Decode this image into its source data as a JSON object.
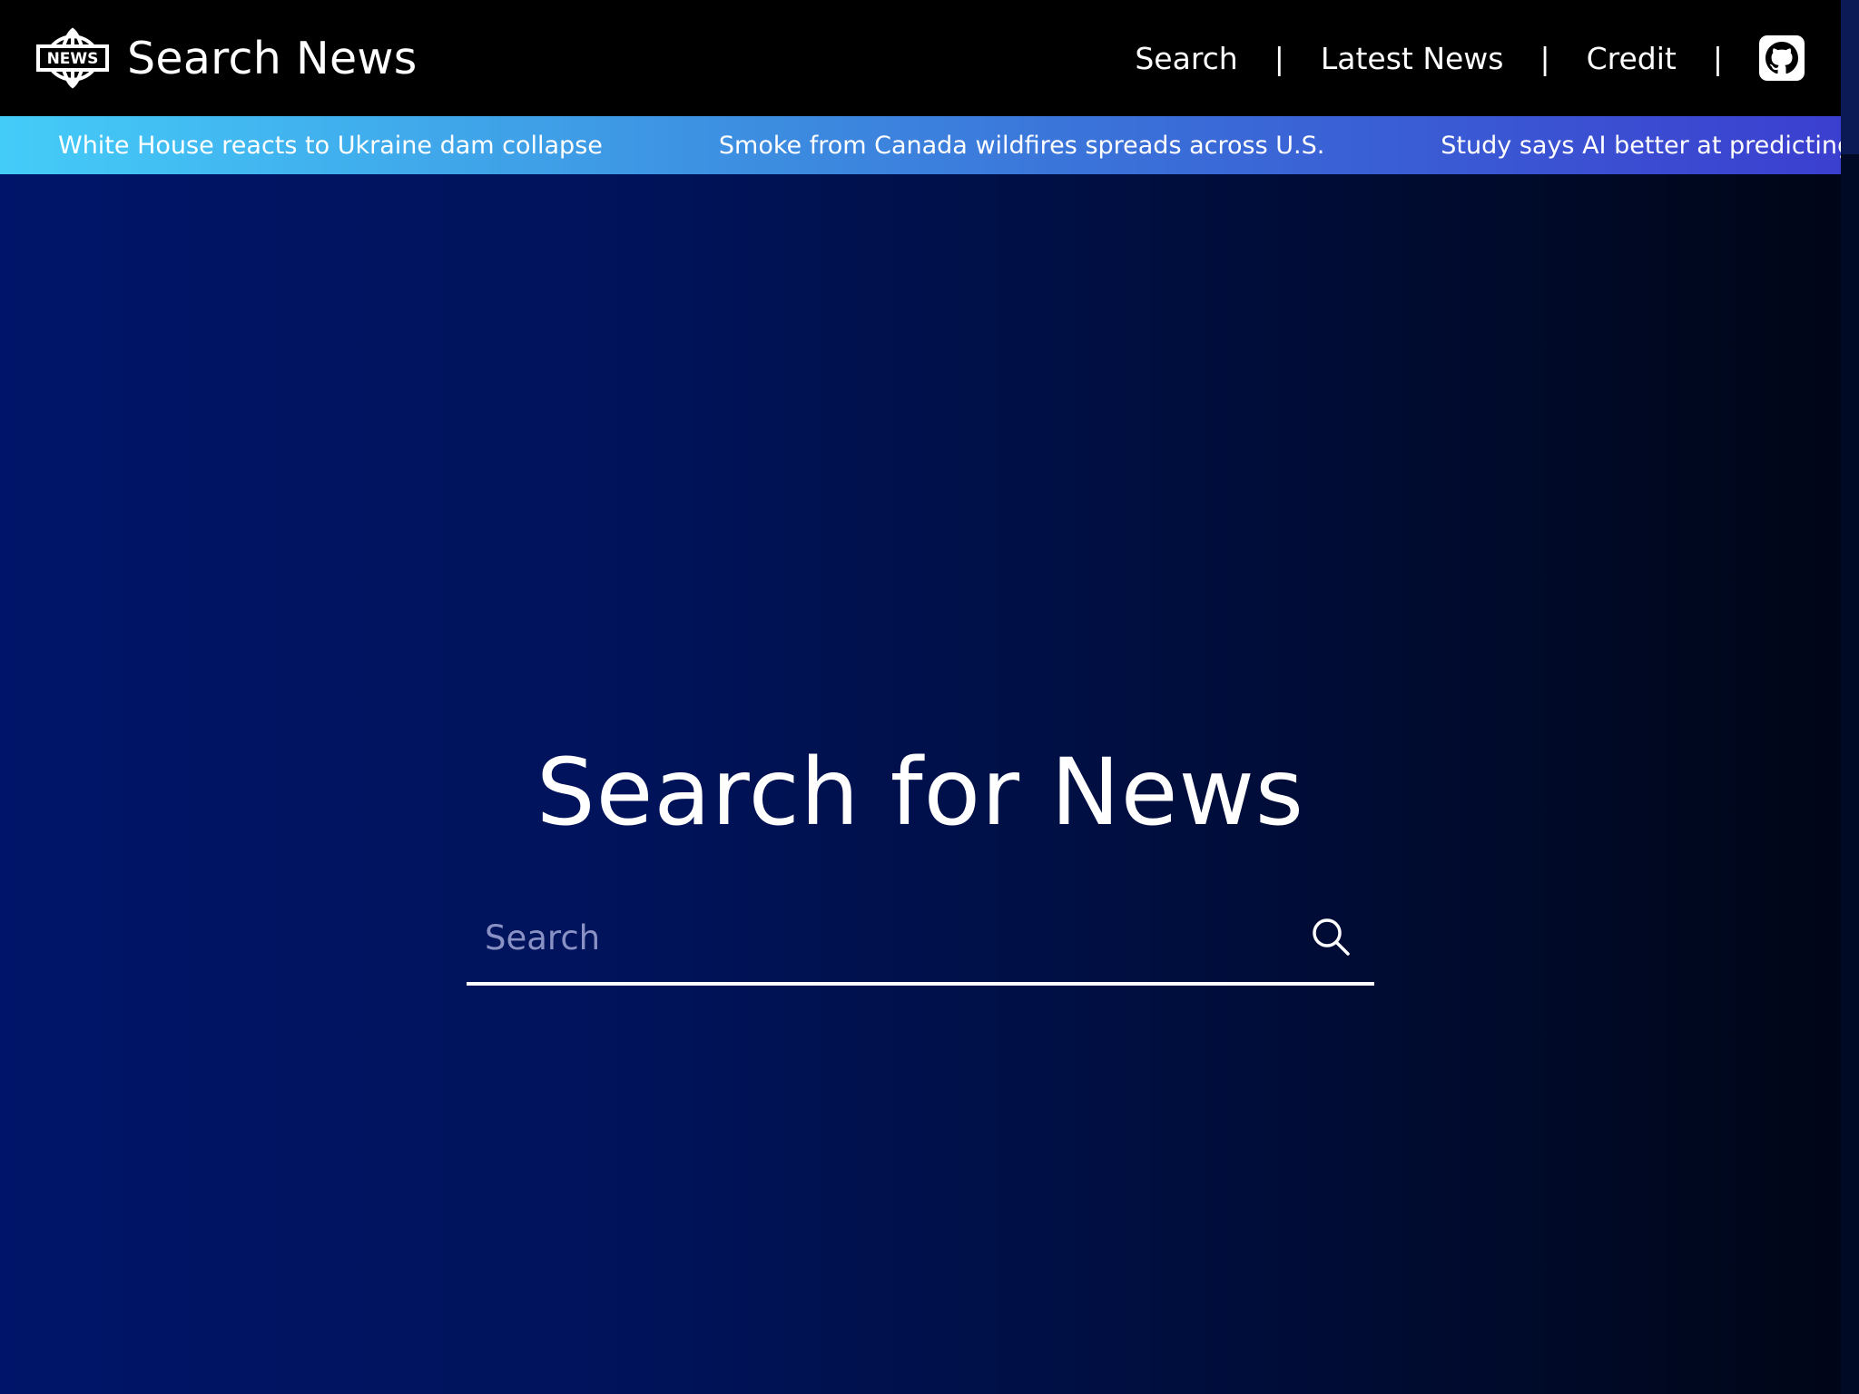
{
  "brand": {
    "logo_text": "NEWS",
    "title": "Search News"
  },
  "nav": {
    "items": [
      "Search",
      "Latest News",
      "Credit"
    ],
    "separator": "|",
    "github_icon": "github-icon"
  },
  "ticker": {
    "headlines": [
      "White House reacts to Ukraine dam collapse",
      "Smoke from Canada wildfires spreads across U.S.",
      "Study says AI better at predicting cancer"
    ]
  },
  "hero": {
    "title": "Search for News",
    "search_placeholder": "Search",
    "search_value": "",
    "search_icon": "search-icon"
  },
  "colors": {
    "header_bg": "#000000",
    "ticker_start": "#44ccf8",
    "ticker_end": "#3b3fcf",
    "page_bg_start": "#001569",
    "page_bg_end": "#000617",
    "placeholder": "#8a91c4"
  }
}
